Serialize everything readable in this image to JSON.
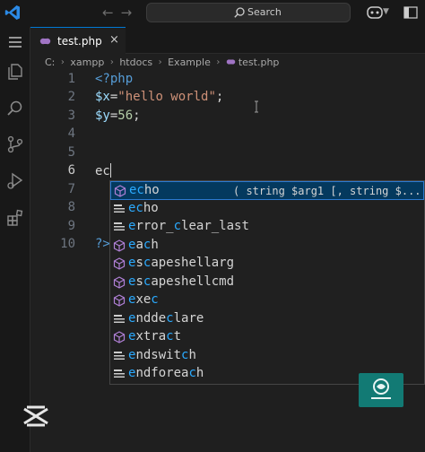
{
  "titlebar": {
    "search_label": "Search"
  },
  "tabs": [
    {
      "label": "test.php",
      "close": "×"
    }
  ],
  "breadcrumb": [
    "C:",
    "xampp",
    "htdocs",
    "Example",
    "test.php"
  ],
  "breadcrumb_sep": "›",
  "editor": {
    "line_numbers": [
      "1",
      "2",
      "3",
      "4",
      "5",
      "6",
      "7",
      "8",
      "9",
      "10"
    ],
    "line1": {
      "tag": "<?php"
    },
    "line2": {
      "var": "$x",
      "op": "=",
      "str": "\"hello world\"",
      "end": ";"
    },
    "line3": {
      "var": "$y",
      "op": "=",
      "num": "56",
      "end": ";"
    },
    "line6": {
      "text": "ec"
    },
    "line10": {
      "tag": "?>"
    }
  },
  "suggest": {
    "items": [
      {
        "pre": "",
        "match": "ec",
        "post": "ho",
        "kind": "function",
        "detail": "( string $arg1 [, string $... ]"
      },
      {
        "pre": "",
        "match": "ec",
        "post": "ho",
        "kind": "snippet"
      },
      {
        "pre": "",
        "match": "e",
        "post": "rror_",
        "match2": "c",
        "post2": "lear_last",
        "kind": "snippet"
      },
      {
        "pre": "",
        "match": "e",
        "post": "a",
        "match2": "c",
        "post2": "h",
        "kind": "function"
      },
      {
        "pre": "",
        "match": "e",
        "post": "s",
        "match2": "c",
        "post2": "apeshellarg",
        "kind": "function"
      },
      {
        "pre": "",
        "match": "e",
        "post": "s",
        "match2": "c",
        "post2": "apeshellcmd",
        "kind": "function"
      },
      {
        "pre": "",
        "match": "e",
        "post": "xe",
        "match2": "c",
        "post2": "",
        "kind": "function"
      },
      {
        "pre": "",
        "match": "e",
        "post": "nd",
        "match2": "",
        "post2": "",
        "post3": "de",
        "match3": "c",
        "post4": "lare",
        "kind": "snippet"
      },
      {
        "pre": "",
        "match": "e",
        "post": "xtra",
        "match2": "c",
        "post2": "t",
        "kind": "function"
      },
      {
        "pre": "",
        "match": "e",
        "post": "ndswit",
        "match2": "c",
        "post2": "h",
        "kind": "snippet"
      },
      {
        "pre": "",
        "match": "e",
        "post": "ndforea",
        "match2": "c",
        "post2": "h",
        "kind": "snippet"
      }
    ]
  },
  "colors": {
    "accent": "#0078d4",
    "selection": "#04395e",
    "match_highlight": "#2aaaff",
    "php_icon": "#a074c4",
    "watermark_bg": "#127a74"
  }
}
